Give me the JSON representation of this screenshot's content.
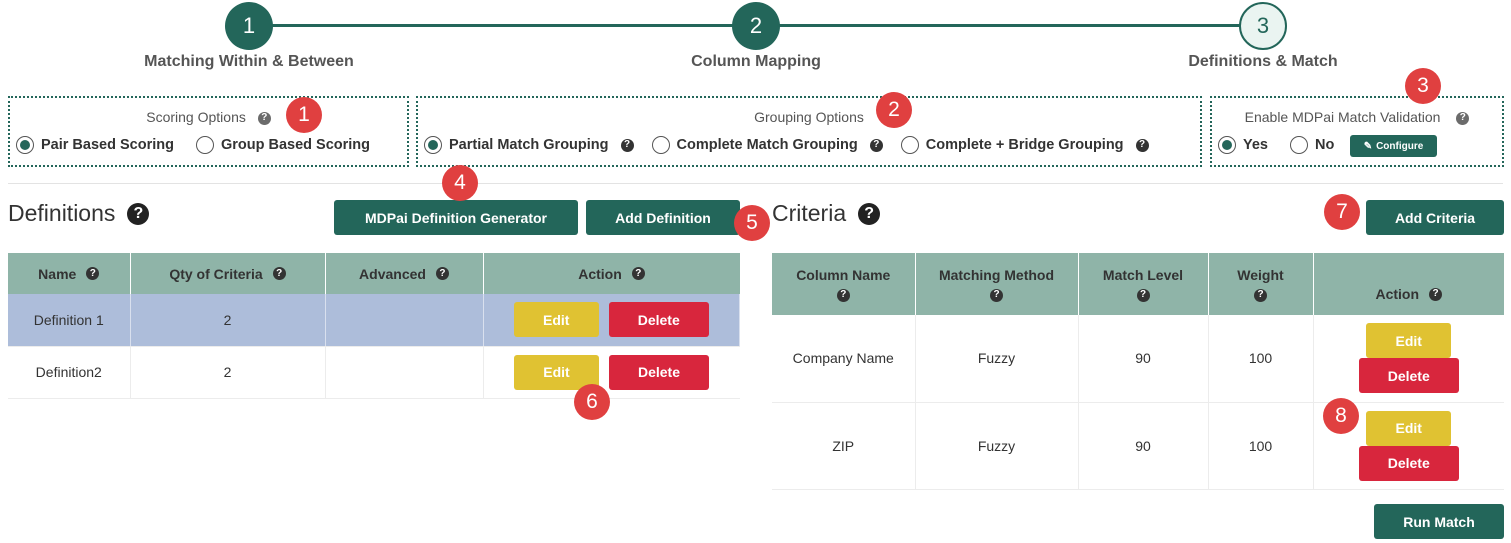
{
  "stepper": {
    "steps": [
      {
        "number": "1",
        "label": "Matching Within & Between"
      },
      {
        "number": "2",
        "label": "Column Mapping"
      },
      {
        "number": "3",
        "label": "Definitions & Match"
      }
    ]
  },
  "scoring_options": {
    "title": "Scoring Options",
    "options": [
      {
        "label": "Pair Based Scoring",
        "checked": true
      },
      {
        "label": "Group Based Scoring",
        "checked": false
      }
    ]
  },
  "grouping_options": {
    "title": "Grouping Options",
    "options": [
      {
        "label": "Partial Match Grouping",
        "checked": true
      },
      {
        "label": "Complete Match Grouping",
        "checked": false
      },
      {
        "label": "Complete + Bridge Grouping",
        "checked": false
      }
    ]
  },
  "validation": {
    "title": "Enable MDPai Match Validation",
    "options": [
      {
        "label": "Yes",
        "checked": true
      },
      {
        "label": "No",
        "checked": false
      }
    ],
    "configure_label": "Configure"
  },
  "badges": [
    "1",
    "2",
    "3",
    "4",
    "5",
    "6",
    "7",
    "8"
  ],
  "help_glyph": "?",
  "definitions": {
    "title": "Definitions",
    "generator_label": "MDPai Definition Generator",
    "add_label": "Add Definition",
    "columns": [
      "Name",
      "Qty of Criteria",
      "Advanced",
      "Action"
    ],
    "rows": [
      {
        "name": "Definition 1",
        "qty": "2",
        "advanced": "",
        "selected": true
      },
      {
        "name": "Definition2",
        "qty": "2",
        "advanced": "",
        "selected": false
      }
    ],
    "edit_label": "Edit",
    "delete_label": "Delete"
  },
  "criteria": {
    "title": "Criteria",
    "add_label": "Add Criteria",
    "columns": [
      "Column Name",
      "Matching Method",
      "Match Level",
      "Weight",
      "Action"
    ],
    "rows": [
      {
        "column": "Company Name",
        "method": "Fuzzy",
        "level": "90",
        "weight": "100"
      },
      {
        "column": "ZIP",
        "method": "Fuzzy",
        "level": "90",
        "weight": "100"
      }
    ],
    "edit_label": "Edit",
    "delete_label": "Delete"
  },
  "run_match_label": "Run Match",
  "colors": {
    "primary": "#23665a",
    "header": "#8fb4a8",
    "selected_row": "#adbdda",
    "edit": "#e0c232",
    "delete": "#d8263d",
    "badge": "#e04040"
  }
}
